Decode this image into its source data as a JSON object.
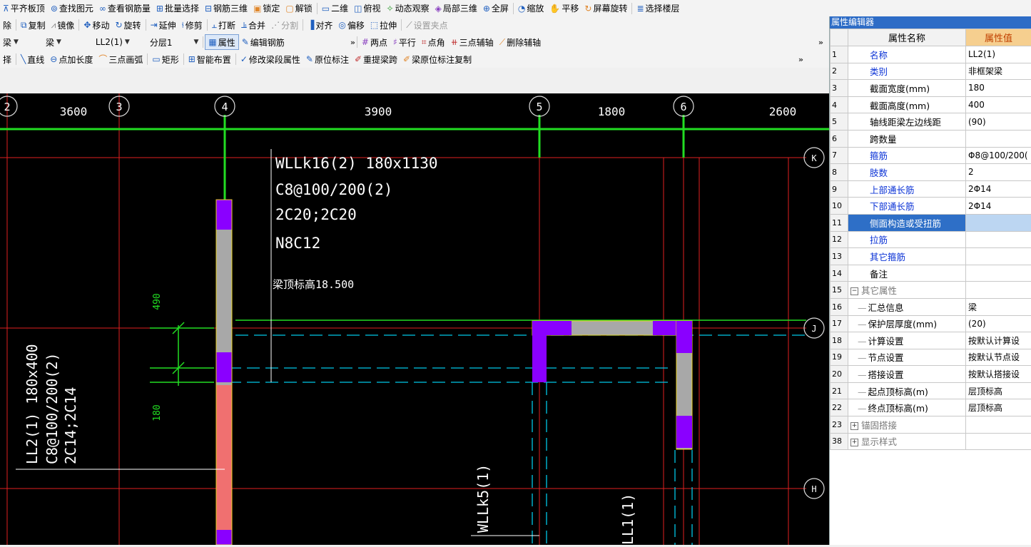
{
  "toolbar1": [
    {
      "name": "pingqi-bandi",
      "icon": "align-top-icon",
      "label": "平齐板顶"
    },
    {
      "name": "find-element",
      "icon": "binoculars-icon",
      "label": "查找图元"
    },
    {
      "name": "view-rebar-qty",
      "icon": "rebar-qty-icon",
      "label": "查看钢筋量"
    },
    {
      "name": "batch-select",
      "icon": "batch-select-icon",
      "label": "批量选择"
    },
    {
      "name": "rebar-3d",
      "icon": "rebar-3d-icon",
      "label": "钢筋三维"
    },
    {
      "name": "lock",
      "icon": "lock-icon",
      "label": "锁定"
    },
    {
      "name": "unlock",
      "icon": "unlock-icon",
      "label": "解锁"
    },
    {
      "name": "view-2d",
      "icon": "2d-view-icon",
      "label": "二维"
    },
    {
      "name": "top-view",
      "icon": "top-view-icon",
      "label": "俯视"
    },
    {
      "name": "dynamic-view",
      "icon": "orbit-icon",
      "label": "动态观察"
    },
    {
      "name": "local-3d",
      "icon": "cube-icon",
      "label": "局部三维"
    },
    {
      "name": "fullscreen",
      "icon": "fullscreen-icon",
      "label": "全屏"
    },
    {
      "name": "zoom",
      "icon": "zoom-icon",
      "label": "缩放"
    },
    {
      "name": "pan",
      "icon": "pan-icon",
      "label": "平移"
    },
    {
      "name": "screen-rotate",
      "icon": "rotate-screen-icon",
      "label": "屏幕旋转"
    },
    {
      "name": "select-floor",
      "icon": "floor-select-icon",
      "label": "选择楼层"
    }
  ],
  "toolbar2": [
    {
      "name": "delete",
      "label": "除"
    },
    {
      "name": "copy",
      "icon": "copy-icon",
      "label": "复制"
    },
    {
      "name": "mirror",
      "icon": "mirror-icon",
      "label": "镜像"
    },
    {
      "name": "move",
      "icon": "move-icon",
      "label": "移动"
    },
    {
      "name": "rotate",
      "icon": "rotate-icon",
      "label": "旋转"
    },
    {
      "name": "extend",
      "icon": "extend-icon",
      "label": "延伸"
    },
    {
      "name": "trim",
      "icon": "trim-icon",
      "label": "修剪"
    },
    {
      "name": "break",
      "icon": "break-icon",
      "label": "打断"
    },
    {
      "name": "merge",
      "icon": "merge-icon",
      "label": "合并"
    },
    {
      "name": "split",
      "icon": "split-icon",
      "label": "分割",
      "disabled": true
    },
    {
      "name": "align",
      "icon": "align-icon",
      "label": "对齐"
    },
    {
      "name": "offset",
      "icon": "offset-icon",
      "label": "偏移"
    },
    {
      "name": "stretch",
      "icon": "stretch-icon",
      "label": "拉伸"
    },
    {
      "name": "set-grip",
      "icon": "grip-icon",
      "label": "设置夹点",
      "disabled": true
    }
  ],
  "toolbar3": {
    "dropdowns": [
      "梁",
      "梁",
      "LL2(1)",
      "分层1"
    ],
    "property_label": "属性",
    "edit_rebar_label": "编辑钢筋",
    "aux": [
      {
        "name": "two-point",
        "icon": "two-point-icon",
        "label": "两点"
      },
      {
        "name": "parallel",
        "icon": "parallel-icon",
        "label": "平行"
      },
      {
        "name": "point-angle",
        "icon": "point-angle-icon",
        "label": "点角"
      },
      {
        "name": "three-point-aux",
        "icon": "three-point-icon",
        "label": "三点辅轴"
      },
      {
        "name": "delete-aux",
        "icon": "delete-aux-icon",
        "label": "删除辅轴"
      }
    ]
  },
  "toolbar4": [
    {
      "name": "select",
      "label": "择"
    },
    {
      "name": "line",
      "icon": "line-icon",
      "label": "直线"
    },
    {
      "name": "point-length",
      "icon": "point-length-icon",
      "label": "点加长度"
    },
    {
      "name": "three-point-arc",
      "icon": "arc-icon",
      "label": "三点画弧"
    },
    {
      "name": "rectangle",
      "icon": "rectangle-icon",
      "label": "矩形"
    },
    {
      "name": "smart-layout",
      "icon": "smart-layout-icon",
      "label": "智能布置"
    },
    {
      "name": "modify-span",
      "icon": "modify-span-icon",
      "label": "修改梁段属性"
    },
    {
      "name": "in-place-annot",
      "icon": "annotation-icon",
      "label": "原位标注"
    },
    {
      "name": "re-extract-span",
      "icon": "re-extract-icon",
      "label": "重提梁跨"
    },
    {
      "name": "copy-annot",
      "icon": "copy-annotation-icon",
      "label": "梁原位标注复制"
    }
  ],
  "colors": {
    "grid_red": "#e02020",
    "axis_green": "#22dd22",
    "beam_purple": "#8a00ff",
    "beam_gray": "#a8a8a8",
    "beam_pink": "#f07070",
    "dash_cyan": "#00c8e8",
    "text_white": "#ffffff",
    "panel_title": "#2d6cc6"
  },
  "axis": {
    "numbers": [
      "2",
      "3",
      "4",
      "5",
      "6"
    ],
    "spans": [
      "3600",
      "3900",
      "1800",
      "2600"
    ],
    "right_labels": [
      "K",
      "J",
      "H"
    ]
  },
  "labels": {
    "wllk16_line1": "WLLk16(2) 180x1130",
    "wllk16_line2": "C8@100/200(2)",
    "wllk16_line3": "2C20;2C20",
    "wllk16_line4": "N8C12",
    "beam_top_elev": "梁顶标高18.500",
    "dim_490": "490",
    "dim_180": "180",
    "ll2_line1": "LL2(1) 180x400",
    "ll2_line2": "C8@100/200(2)",
    "ll2_line3": "2C14;2C14",
    "wllk5": "WLLk5(1)",
    "ll1": "LL1(1)"
  },
  "panel": {
    "title": "属性编辑器",
    "header_name": "属性名称",
    "header_value": "属性值",
    "rows": [
      {
        "num": "1",
        "name": "名称",
        "value": "LL2(1)",
        "style": "blue"
      },
      {
        "num": "2",
        "name": "类别",
        "value": "非框架梁",
        "style": "blue"
      },
      {
        "num": "3",
        "name": "截面宽度(mm)",
        "value": "180",
        "style": "normal"
      },
      {
        "num": "4",
        "name": "截面高度(mm)",
        "value": "400",
        "style": "normal"
      },
      {
        "num": "5",
        "name": "轴线距梁左边线距",
        "value": "(90)",
        "style": "normal"
      },
      {
        "num": "6",
        "name": "跨数量",
        "value": "",
        "style": "normal"
      },
      {
        "num": "7",
        "name": "箍筋",
        "value": "Φ8@100/200(",
        "style": "blue"
      },
      {
        "num": "8",
        "name": "肢数",
        "value": "2",
        "style": "blue"
      },
      {
        "num": "9",
        "name": "上部通长筋",
        "value": "2Φ14",
        "style": "blue"
      },
      {
        "num": "10",
        "name": "下部通长筋",
        "value": "2Φ14",
        "style": "blue"
      },
      {
        "num": "11",
        "name": "侧面构造或受扭筋",
        "value": "",
        "style": "blue",
        "selected": true
      },
      {
        "num": "12",
        "name": "拉筋",
        "value": "",
        "style": "blue"
      },
      {
        "num": "13",
        "name": "其它箍筋",
        "value": "",
        "style": "blue"
      },
      {
        "num": "14",
        "name": "备注",
        "value": "",
        "style": "normal"
      },
      {
        "num": "15",
        "name": "其它属性",
        "value": "",
        "style": "group",
        "box": "−"
      },
      {
        "num": "16",
        "name": "汇总信息",
        "value": "梁",
        "style": "normal",
        "tree": true
      },
      {
        "num": "17",
        "name": "保护层厚度(mm)",
        "value": "(20)",
        "style": "normal",
        "tree": true
      },
      {
        "num": "18",
        "name": "计算设置",
        "value": "按默认计算设",
        "style": "normal",
        "tree": true
      },
      {
        "num": "19",
        "name": "节点设置",
        "value": "按默认节点设",
        "style": "normal",
        "tree": true
      },
      {
        "num": "20",
        "name": "搭接设置",
        "value": "按默认搭接设",
        "style": "normal",
        "tree": true
      },
      {
        "num": "21",
        "name": "起点顶标高(m)",
        "value": "层顶标高",
        "style": "normal",
        "tree": true
      },
      {
        "num": "22",
        "name": "终点顶标高(m)",
        "value": "层顶标高",
        "style": "normal",
        "tree": true
      },
      {
        "num": "23",
        "name": "锚固搭接",
        "value": "",
        "style": "group",
        "box": "+"
      },
      {
        "num": "38",
        "name": "显示样式",
        "value": "",
        "style": "group",
        "box": "+"
      }
    ]
  }
}
